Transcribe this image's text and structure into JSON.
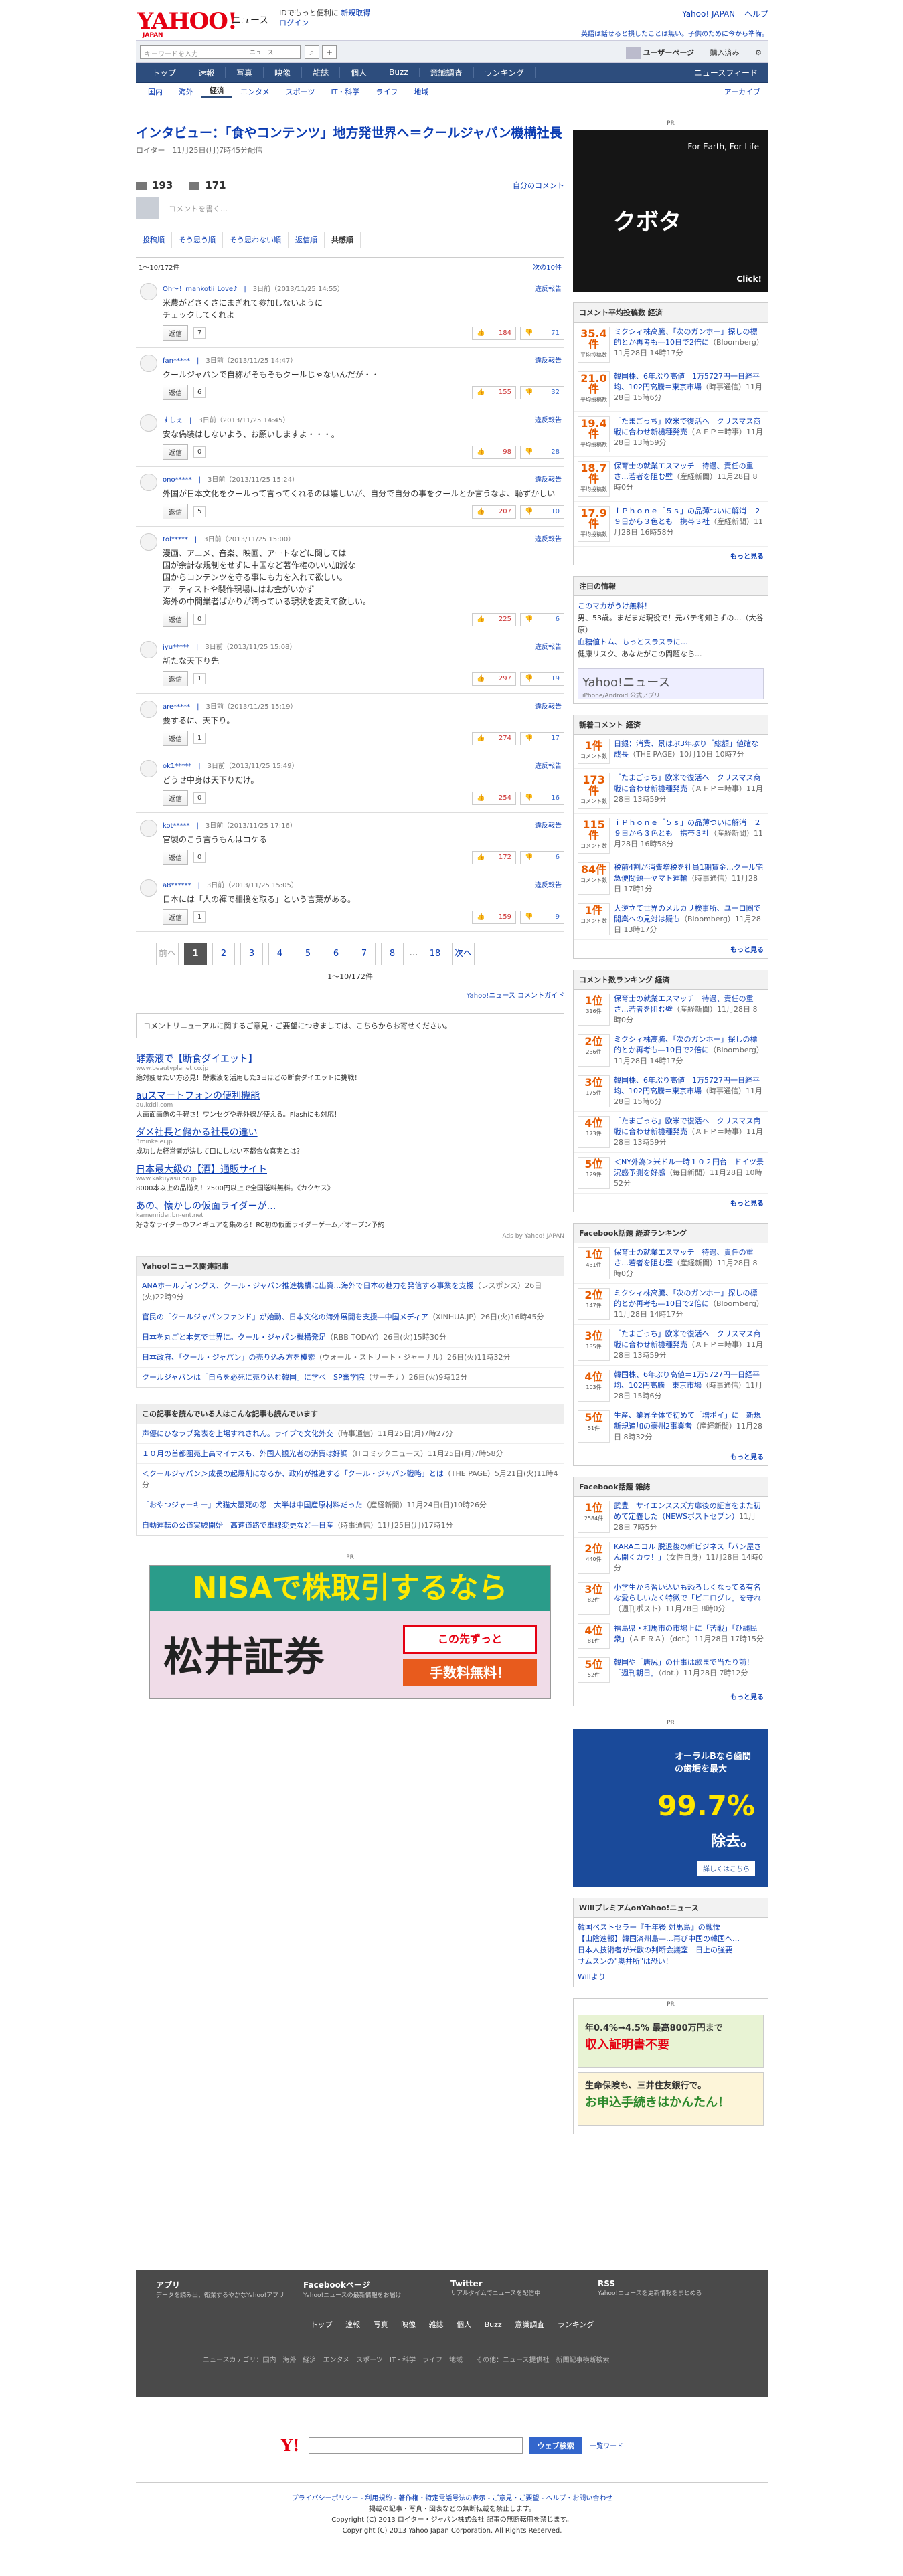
{
  "header": {
    "logo": "YAHOO!",
    "logo_sub": "JAPAN",
    "service": "ニュース",
    "promo_line1": "IDでもっと便利に",
    "promo_signup": "新規取得",
    "promo_login": "ログイン",
    "top_links": [
      "Yahoo! JAPAN",
      "ヘルプ"
    ],
    "tagline": "英語は話せると損したことは無い。子供のために今から準備。"
  },
  "search": {
    "placeholder": "キーワードを入力",
    "scope": "ニュース",
    "user_page": "ユーザーページ",
    "subscribed": "購入済み"
  },
  "nav": {
    "items": [
      "トップ",
      "速報",
      "写真",
      "映像",
      "雑誌",
      "個人",
      "Buzz",
      "意識調査",
      "ランキング"
    ],
    "feed": "ニュースフィード"
  },
  "subnav": {
    "items": [
      "国内",
      "海外",
      "経済",
      "エンタメ",
      "スポーツ",
      "IT・科学",
      "ライフ",
      "地域"
    ],
    "active_index": 2,
    "archive": "アーカイブ"
  },
  "article": {
    "title": "インタビュー：「食やコンテンツ」地方発世界へ＝クールジャパン機構社長",
    "byline": "ロイター　11月25日(月)7時45分配信"
  },
  "comments_meta": {
    "comment_count": "193",
    "user_count": "171",
    "own_link": "自分のコメント",
    "compose_placeholder": "コメントを書く…",
    "tabs": [
      "投稿順",
      "そう思う順",
      "そう思わない順",
      "返信順",
      "共感順"
    ],
    "selected_tab": 4,
    "range": "1〜10/172件",
    "next_link": "次の10件"
  },
  "comments": [
    {
      "user": "Oh〜！mankotii!Love♪",
      "time": "3日前（2013/11/25 14:55）",
      "text": "米農がどさくさにまぎれて参加しないように\nチェックしてくれよ",
      "replies": "7",
      "agree": "184",
      "disagree": "71"
    },
    {
      "user": "fan*****",
      "time": "3日前（2013/11/25 14:47）",
      "text": "クールジャパンで自称がそもそもクールじゃないんだが・・",
      "replies": "6",
      "agree": "155",
      "disagree": "32"
    },
    {
      "user": "すしぇ",
      "time": "3日前（2013/11/25 14:45）",
      "text": "安な偽装はしないよう、お願いしますよ・・・。",
      "replies": "0",
      "agree": "98",
      "disagree": "28"
    },
    {
      "user": "ono*****",
      "time": "3日前（2013/11/25 15:24）",
      "text": "外国が日本文化をクールって言ってくれるのは嬉しいが、自分で自分の事をクールとか言うなよ、恥ずかしい",
      "replies": "5",
      "agree": "207",
      "disagree": "10"
    },
    {
      "user": "tol*****",
      "time": "3日前（2013/11/25 15:00）",
      "text": "漫画、アニメ、音楽、映画、アートなどに関しては\n国が余計な規制をせずに中国など著作権のいい加減な\n国からコンテンツを守る事にも力を入れて欲しい。\nアーティストや製作現場にはお金がいかず\n海外の中間業者ばかりが潤っている現状を変えて欲しい。",
      "replies": "0",
      "agree": "225",
      "disagree": "6"
    },
    {
      "user": "jyu*****",
      "time": "3日前（2013/11/25 15:08）",
      "text": "新たな天下り先",
      "replies": "1",
      "agree": "297",
      "disagree": "19"
    },
    {
      "user": "are*****",
      "time": "3日前（2013/11/25 15:19）",
      "text": "要するに、天下り。",
      "replies": "1",
      "agree": "274",
      "disagree": "17"
    },
    {
      "user": "ok1*****",
      "time": "3日前（2013/11/25 15:49）",
      "text": "どうせ中身は天下りだけ。",
      "replies": "0",
      "agree": "254",
      "disagree": "16"
    },
    {
      "user": "kot*****",
      "time": "3日前（2013/11/25 17:16）",
      "text": "官製のこう言うもんはコケる",
      "replies": "0",
      "agree": "172",
      "disagree": "6"
    },
    {
      "user": "a8******",
      "time": "3日前（2013/11/25 15:05）",
      "text": "日本には「人の褌で相撲を取る」という言葉がある。",
      "replies": "1",
      "agree": "159",
      "disagree": "9"
    }
  ],
  "reply_label": "返信",
  "report_label": "違反報告",
  "pager": {
    "prev": "前へ",
    "pages": [
      "1",
      "2",
      "3",
      "4",
      "5",
      "6",
      "7",
      "8"
    ],
    "ellipsis": "…",
    "last": "18",
    "next": "次へ",
    "info": "1〜10/172件",
    "guide": "Yahoo!ニュース コメントガイド"
  },
  "renewal_notice": "コメントリニューアルに関するご意見・ご要望につきましては、こちらからお寄せください。",
  "text_ads": [
    {
      "title": "酵素液で【断食ダイエット】",
      "url": "www.beautyplanet.co.jp",
      "desc": "絶対痩せたい方必見！酵素液を活用した3日ほどの断食ダイエットに挑戦！"
    },
    {
      "title": "auスマートフォンの便利機能",
      "url": "au.kddi.com",
      "desc": "大画面画像の手軽さ！ワンセグや赤外線が使える。Flashにも対応！"
    },
    {
      "title": "ダメ社長と儲かる社長の違い",
      "url": "3minkeiei.jp",
      "desc": "成功した経営者が決して口にしない不都合な真実とは？"
    },
    {
      "title": "日本最大級の【酒】通販サイト",
      "url": "www.kakuyasu.co.jp",
      "desc": "8000本以上の品揃え！2500円以上で全国送料無料。《カクヤス》"
    },
    {
      "title": "あの、懐かしの仮面ライダーが…",
      "url": "kamenrider.bn-ent.net",
      "desc": "好きなライダーのフィギュアを集めろ！RC初の仮面ライダーゲーム／オープン予約"
    }
  ],
  "ads_by": "Ads by Yahoo! JAPAN",
  "related": {
    "header": "Yahoo!ニュース関連記事",
    "items": [
      {
        "title": "ANAホールディングス、クール・ジャパン推進機構に出資…海外で日本の魅力を発信する事業を支援",
        "src": "（レスポンス）26日(火)22時9分"
      },
      {
        "title": "官民の「クールジャパンファンド」が始動、日本文化の海外展開を支援―中国メディア",
        "src": "（XINHUA.JP）26日(火)16時45分"
      },
      {
        "title": "日本を丸ごと本気で世界に。クール・ジャパン機構発足",
        "src": "（RBB TODAY）26日(火)15時30分"
      },
      {
        "title": "日本政府、「クール・ジャパン」の売り込み方を模索",
        "src": "（ウォール・ストリート・ジャーナル）26日(火)11時32分"
      },
      {
        "title": "クールジャパンは「自らを必死に売り込む韓国」に学べ＝SP審学院",
        "src": "（サーチナ）26日(火)9時12分"
      }
    ]
  },
  "also_read": {
    "header": "この記事を読んでいる人はこんな記事も読んでいます",
    "items": [
      {
        "title": "声優にひなラブ発表を上場すれされん。ライブで文化外交",
        "src": "（時事通信）11月25日(月)7時27分"
      },
      {
        "title": "１０月の首都圏売上高マイナスも、外国人観光者の消費は好調",
        "src": "（ITコミックニュース）11月25日(月)7時58分"
      },
      {
        "title": "＜クールジャパン＞成長の起爆剤になるか、政府が推進する「クール・ジャパン戦略」とは",
        "src": "（THE PAGE）5月21日(火)11時4分"
      },
      {
        "title": "「おやつジャーキー」犬猫大量死の怨　大半は中国産原材料だった",
        "src": "（産経新聞）11月24日(日)10時26分"
      },
      {
        "title": "自動運転の公道実験開始＝高速道路で車線変更など—日産",
        "src": "（時事通信）11月25日(月)17時1分"
      }
    ]
  },
  "banner_ad": {
    "pr": "PR",
    "line1": "NISAで株取引するなら",
    "brand": "松井証券",
    "badge1": "この先ずっと",
    "badge2": "手数料無料！"
  },
  "sidebar": {
    "pr": "PR",
    "kubota": {
      "caption": "For Earth, For Life",
      "brand": "クボタ",
      "click": "Click!"
    },
    "avg_rank": {
      "header": "コメント平均投稿数 経済",
      "items": [
        {
          "num": "35.4件",
          "unit": "平均投稿数",
          "title": "ミクシィ株高騰、「次のガンホー」探しの標的とか再考も―10日で2倍に",
          "src": "（Bloomberg）11月28日 14時17分"
        },
        {
          "num": "21.0件",
          "unit": "平均投稿数",
          "title": "韓国株、6年ぶり高値＝1万5727円一日経平均、102円高騰＝東京市場",
          "src": "（時事通信）11月28日 15時6分"
        },
        {
          "num": "19.4件",
          "unit": "平均投稿数",
          "title": "「たまごっち」欧米で復活へ　クリスマス商戦に合わせ新機種発売",
          "src": "（ＡＦＰ＝時事）11月28日 13時59分"
        },
        {
          "num": "18.7件",
          "unit": "平均投稿数",
          "title": "保育士の就業エスマッチ　待遇、責任の重さ…若者を阻む壁",
          "src": "（産経新聞）11月28日 8時0分"
        },
        {
          "num": "17.9件",
          "unit": "平均投稿数",
          "title": "ｉＰｈｏｎｅ「５ｓ」の品薄ついに解消　２９日から３色とも　携帯３社",
          "src": "（産経新聞）11月28日 16時58分"
        }
      ],
      "more": "もっと見る"
    },
    "notice": {
      "header": "注目の情報",
      "items": [
        "このマカがうけ無料！",
        "男、53歳。まだまだ現役で！元バテ冬知らずの…（大谷原）",
        "血糖値トム、もっとスラスラに…",
        "健康リスク、あなたがこの問題なら..."
      ],
      "app": "Yahoo!ニュース",
      "app_sub": "iPhone/Android 公式アプリ"
    },
    "new_count": {
      "header": "新着コメント 経済",
      "items": [
        {
          "num": "1件",
          "unit": "コメント数",
          "title": "日銀：消費、景はぶ3年ぶり「総額」値確な成長",
          "src": "（THE PAGE）10月10日 10時7分"
        },
        {
          "num": "173件",
          "unit": "コメント数",
          "title": "「たまごっち」欧米で復活へ　クリスマス商戦に合わせ新機種発売",
          "src": "（ＡＦＰ＝時事）11月28日 13時59分"
        },
        {
          "num": "115件",
          "unit": "コメント数",
          "title": "ｉＰｈｏｎｅ「５ｓ」の品薄ついに解消　２９日から３色とも　携帯３社",
          "src": "（産経新聞）11月28日 16時58分"
        },
        {
          "num": "84件",
          "unit": "コメント数",
          "title": "税前4割が消費増税を社員1期賃金…クール宅急便問題—ヤマト運輸",
          "src": "（時事通信）11月28日 17時1分"
        },
        {
          "num": "1件",
          "unit": "コメント数",
          "title": "大逆立て世界のメルカリ検事所、ユーロ圏で開業への見対は疑も",
          "src": "（Bloomberg）11月28日 13時17分"
        }
      ],
      "more": "もっと見る"
    },
    "count_rank": {
      "header": "コメント数ランキング 経済",
      "items": [
        {
          "num": "1位",
          "unit": "316件",
          "title": "保育士の就業エスマッチ　待遇、責任の重さ…若者を阻む壁",
          "src": "（産経新聞）11月28日 8時0分"
        },
        {
          "num": "2位",
          "unit": "236件",
          "title": "ミクシィ株高騰、「次のガンホー」探しの標的とか再考も―10日で2倍に",
          "src": "（Bloomberg）11月28日 14時17分"
        },
        {
          "num": "3位",
          "unit": "175件",
          "title": "韓国株、6年ぶり高値＝1万5727円一日経平均、102円高騰＝東京市場",
          "src": "（時事通信）11月28日 15時6分"
        },
        {
          "num": "4位",
          "unit": "173件",
          "title": "「たまごっち」欧米で復活へ　クリスマス商戦に合わせ新機種発売",
          "src": "（ＡＦＰ＝時事）11月28日 13時59分"
        },
        {
          "num": "5位",
          "unit": "129件",
          "title": "＜NY外為＞米ドル一時１０２円台　ドイツ景況感予測を好感",
          "src": "（毎日新聞）11月28日 10時52分"
        }
      ],
      "more": "もっと見る"
    },
    "fb_econ": {
      "header": "Facebook話題 経済ランキング",
      "items": [
        {
          "num": "1位",
          "unit": "431件",
          "title": "保育士の就業エスマッチ　待遇、責任の重さ…若者を阻む壁",
          "src": "（産経新聞）11月28日 8時0分"
        },
        {
          "num": "2位",
          "unit": "147件",
          "title": "ミクシィ株高騰、「次のガンホー」探しの標的とか再考も―10日で2倍に",
          "src": "（Bloomberg）11月28日 14時17分"
        },
        {
          "num": "3位",
          "unit": "135件",
          "title": "「たまごっち」欧米で復活へ　クリスマス商戦に合わせ新機種発売",
          "src": "（ＡＦＰ＝時事）11月28日 13時59分"
        },
        {
          "num": "4位",
          "unit": "103件",
          "title": "韓国株、6年ぶり高値＝1万5727円一日経平均、102円高騰＝東京市場",
          "src": "（時事通信）11月28日 15時6分"
        },
        {
          "num": "5位",
          "unit": "51件",
          "title": "生産、業界全体で初めて「増ポイ」に　新規新規追加の豪州2事業者",
          "src": "（産経新聞）11月28日 8時32分"
        }
      ],
      "more": "もっと見る"
    },
    "fb_mag": {
      "header": "Facebook話題 雑誌",
      "items": [
        {
          "num": "1位",
          "unit": "2584件",
          "title": "武豊　サイエンススズ方扉後の証言をまた初めて定義した（NEWSポストセブン）",
          "src": "11月28日 7時5分"
        },
        {
          "num": "2位",
          "unit": "440件",
          "title": "KARAニコル 脱退後の新ビジネス「バン屋さん開くカウ！」",
          "src": "（女性自身）11月28日 14時0分"
        },
        {
          "num": "3位",
          "unit": "82件",
          "title": "小学生から習い込いも恐ろしくなってる有名な愛らしいたく特徴で「ピエログレ」を守れ",
          "src": "（週刊ポスト）11月28日 8時0分"
        },
        {
          "num": "4位",
          "unit": "81件",
          "title": "福島県・相馬市の市場上に「苦戦」「ひ縄民衆」",
          "src": "（ＡＥＲＡ）（dot.）11月28日 17時15分"
        },
        {
          "num": "5位",
          "unit": "52件",
          "title": "韓国や「唐尻」の仕事は歌まで当たり前！「週刊朝日」",
          "src": "（dot.）11月28日 7時12分"
        }
      ],
      "more": "もっと見る"
    },
    "ad2": {
      "pr": "PR",
      "text": "オーラルBなら歯間の歯垢を最大",
      "pct": "99.7%",
      "tail": "除去。",
      "btn": "詳しくはこちら"
    },
    "premium": {
      "header": "WillプレミアムonYahoo!ニュース",
      "items": [
        "韓国ベストセラー『千年後 対馬島』の戦慄",
        "【山陰速報】韓国済州島—…再び中国の韓国へ…",
        "日本人技術者が米欧の判断会議室　日上の強要\nサムスンの\"奥井所\"は恐い！"
      ],
      "foot": "Willより"
    },
    "ad3": {
      "pr": "PR",
      "a_line1": "年0.4%→4.5% 最高800万円まで",
      "a_line2": "収入証明書不要",
      "b_line1": "生命保険も、三井住友銀行で。",
      "b_line2": "お申込手続きはかんたん！"
    }
  },
  "footer": {
    "cols": [
      {
        "title": "アプリ",
        "sub": "データを読み出、衛業するやかなYahoo!アプリ"
      },
      {
        "title": "Facebookページ",
        "sub": "Yahoo!ニュースの最新情報をお届け"
      },
      {
        "title": "Twitter",
        "sub": "リアルタイムでニュースを配信中"
      },
      {
        "title": "RSS",
        "sub": "Yahoo!ニュースを更新情報をまとめる"
      }
    ],
    "nav": [
      "トップ",
      "速報",
      "写真",
      "映像",
      "雑誌",
      "個人",
      "Buzz",
      "意識調査",
      "ランキング"
    ],
    "cats": "ニュースカテゴリ：国内　海外　経済　エンタメ　スポーツ　IT・科学　ライフ　地域　　その他：ニュース提供社　新聞記事横断検索",
    "search_btn": "ウェブ検索",
    "help": "一覧ワード",
    "links": "プライバシーポリシー - 利用規約 - 著作権・特定電話号法の表示 - ご意見・ご要望 - ヘルプ・お問い合わせ",
    "notice": "掲載の記事・写真・図表などの無断転載を禁止します。",
    "copy1": "Copyright (C) 2013 ロイター・ジャパン株式会社 記事の無断転用を禁じます。",
    "copy2": "Copyright (C) 2013 Yahoo Japan Corporation. All Rights Reserved."
  }
}
